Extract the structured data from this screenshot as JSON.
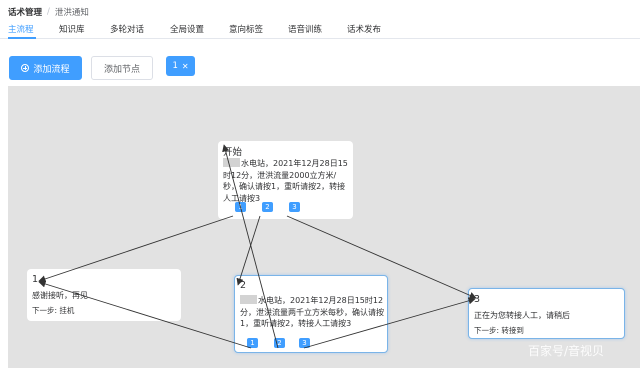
{
  "breadcrumb": {
    "parent": "话术管理",
    "separator": "/",
    "current": "泄洪通知"
  },
  "tabs": [
    {
      "label": "主流程",
      "active": true
    },
    {
      "label": "知识库",
      "active": false
    },
    {
      "label": "多轮对话",
      "active": false
    },
    {
      "label": "全局设置",
      "active": false
    },
    {
      "label": "意向标签",
      "active": false
    },
    {
      "label": "语音训练",
      "active": false
    },
    {
      "label": "话术发布",
      "active": false
    }
  ],
  "toolbar": {
    "add_flow_label": "添加流程",
    "add_node_label": "添加节点",
    "flow_tag_label": "1"
  },
  "nodes": {
    "start": {
      "title": "开始",
      "content": "水电站，2021年12月28日15时12分，泄洪流量2000立方米/秒，确认请按1，重听请按2，转接人工请按3",
      "ports": [
        "1",
        "2",
        "3"
      ]
    },
    "n1": {
      "title": "1",
      "content": "感谢接听，再见",
      "next": "下一步: 挂机"
    },
    "n2": {
      "title": "2",
      "content": "水电站，2021年12月28日15时12分，泄洪流量两千立方米每秒，确认请按1，重听请按2，转接人工请按3",
      "ports": [
        "1",
        "2",
        "3"
      ]
    },
    "n3": {
      "title": "3",
      "content": "正在为您转接人工，请稍后",
      "next": "下一步: 转接到"
    }
  },
  "colors": {
    "primary": "#409eff",
    "canvas_bg": "#e2e2e2",
    "edge": "#333333"
  },
  "watermark": "百家号/音视贝"
}
